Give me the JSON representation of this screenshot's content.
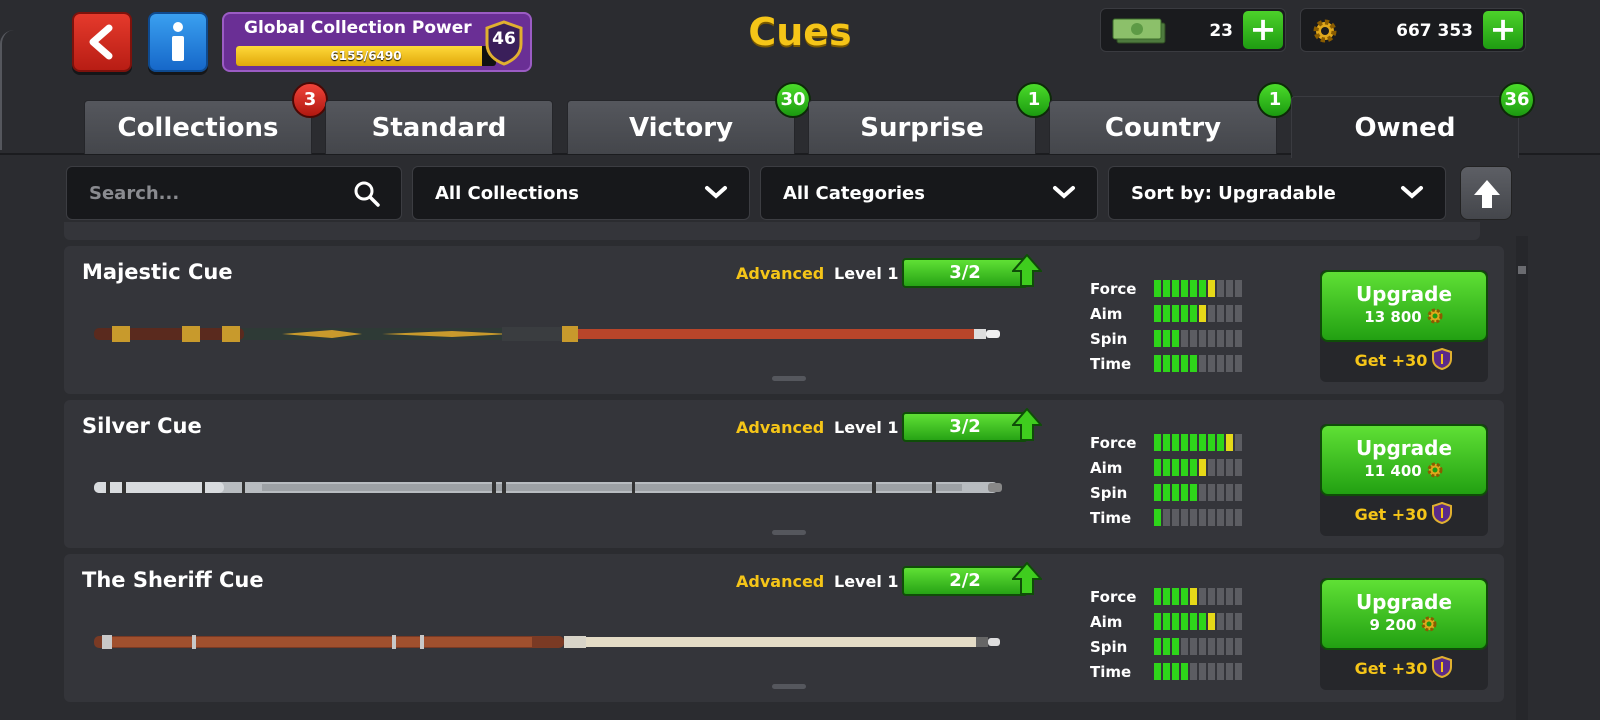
{
  "header": {
    "title": "Cues",
    "power": {
      "label": "Global Collection Power",
      "value_text": "6155/6490",
      "progress": 0.948,
      "level": "46"
    },
    "cash": "23",
    "coins": "667 353"
  },
  "tabs": [
    {
      "label": "Collections",
      "badge": "3",
      "badge_color": "red"
    },
    {
      "label": "Standard",
      "badge": ""
    },
    {
      "label": "Victory",
      "badge": "30",
      "badge_color": "green"
    },
    {
      "label": "Surprise",
      "badge": "1",
      "badge_color": "green"
    },
    {
      "label": "Country",
      "badge": "1",
      "badge_color": "green"
    },
    {
      "label": "Owned",
      "badge": "36",
      "badge_color": "green",
      "active": true
    }
  ],
  "filters": {
    "search_placeholder": "Search...",
    "collections": "All Collections",
    "categories": "All Categories",
    "sort": "Sort by: Upgradable"
  },
  "stat_labels": [
    "Force",
    "Aim",
    "Spin",
    "Time"
  ],
  "cues": [
    {
      "name": "Majestic Cue",
      "tier": "Advanced",
      "level": "Level 1",
      "progress": "3/2",
      "stats": {
        "force": [
          6,
          1
        ],
        "aim": [
          5,
          1
        ],
        "spin": [
          3,
          0
        ],
        "time": [
          5,
          0
        ]
      },
      "upgrade_label": "Upgrade",
      "upgrade_cost": "13 800",
      "bonus": "Get +30"
    },
    {
      "name": "Silver Cue",
      "tier": "Advanced",
      "level": "Level 1",
      "progress": "3/2",
      "stats": {
        "force": [
          8,
          1
        ],
        "aim": [
          5,
          1
        ],
        "spin": [
          5,
          0
        ],
        "time": [
          1,
          0
        ]
      },
      "upgrade_label": "Upgrade",
      "upgrade_cost": "11 400",
      "bonus": "Get +30"
    },
    {
      "name": "The Sheriff Cue",
      "tier": "Advanced",
      "level": "Level 1",
      "progress": "2/2",
      "stats": {
        "force": [
          4,
          1
        ],
        "aim": [
          6,
          1
        ],
        "spin": [
          3,
          0
        ],
        "time": [
          4,
          0
        ]
      },
      "upgrade_label": "Upgrade",
      "upgrade_cost": "9 200",
      "bonus": "Get +30"
    }
  ],
  "colors": {
    "gold": "#f5c518",
    "green": "#2ed51a",
    "purple": "#6a2f95",
    "background": "#2b2c30"
  }
}
